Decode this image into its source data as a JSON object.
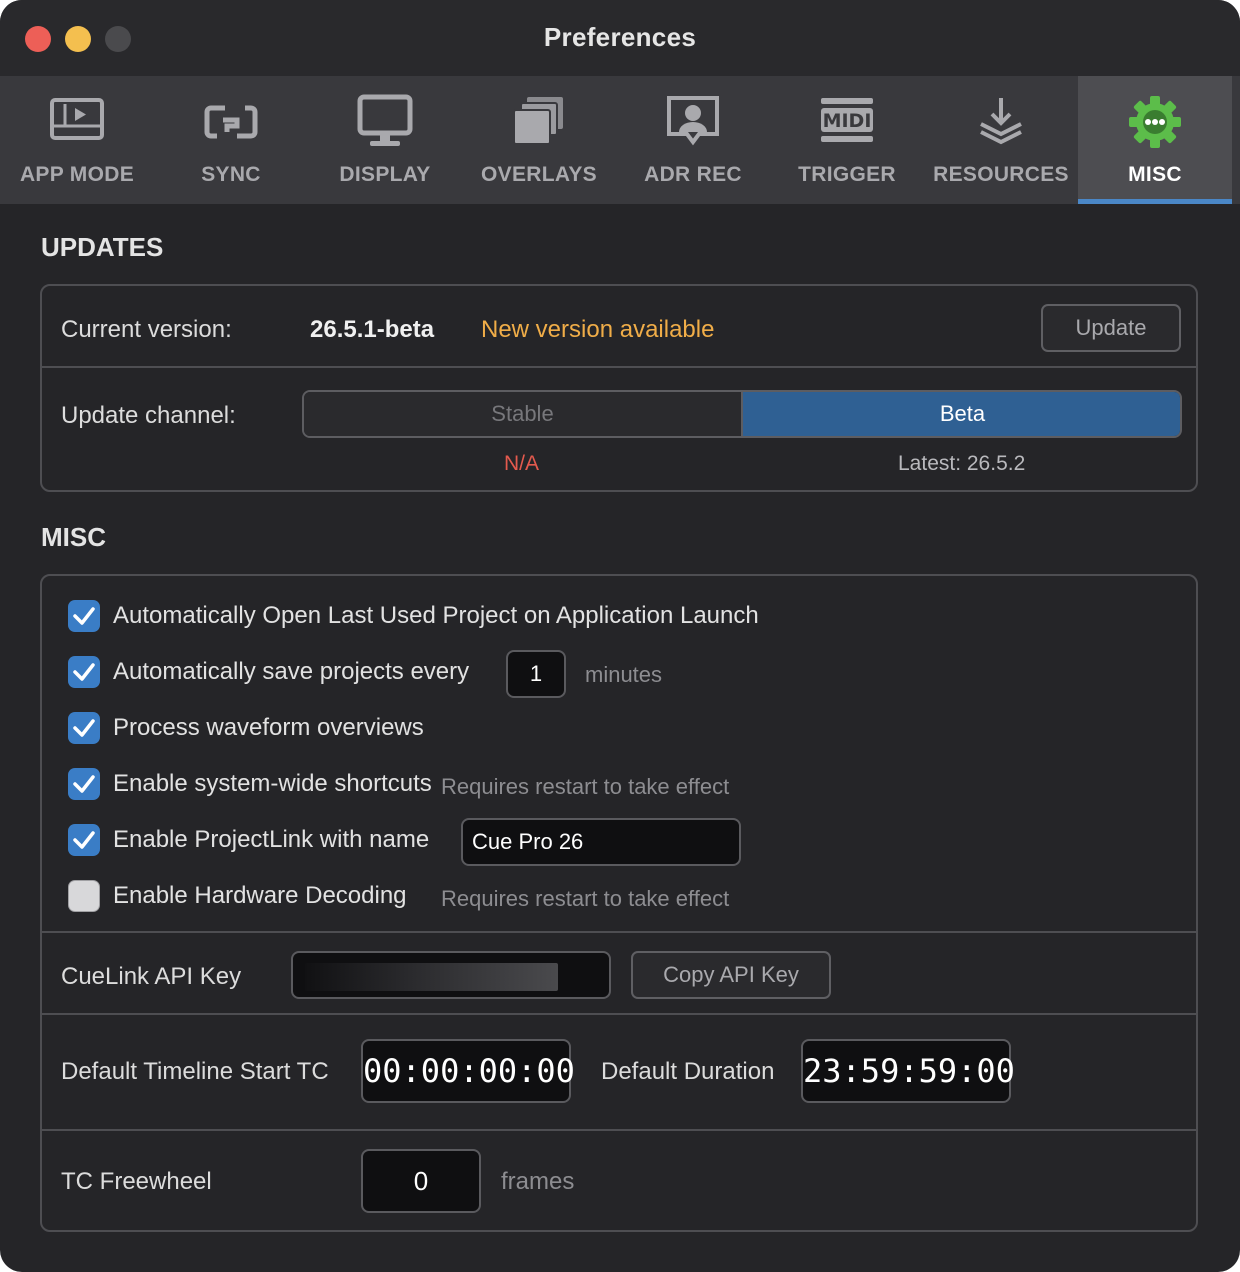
{
  "window": {
    "title": "Preferences"
  },
  "tabs": [
    {
      "label": "APP MODE",
      "icon": "app-mode-icon",
      "active": false
    },
    {
      "label": "SYNC",
      "icon": "sync-icon",
      "active": false
    },
    {
      "label": "DISPLAY",
      "icon": "display-icon",
      "active": false
    },
    {
      "label": "OVERLAYS",
      "icon": "overlays-icon",
      "active": false
    },
    {
      "label": "ADR REC",
      "icon": "adr-rec-icon",
      "active": false
    },
    {
      "label": "TRIGGER",
      "icon": "midi-icon",
      "active": false
    },
    {
      "label": "RESOURCES",
      "icon": "resources-icon",
      "active": false
    },
    {
      "label": "MISC",
      "icon": "gear-icon",
      "active": true
    }
  ],
  "updates": {
    "title": "UPDATES",
    "current_version_label": "Current version:",
    "current_version": "26.5.1-beta",
    "new_version_notice": "New version available",
    "update_button": "Update",
    "channel_label": "Update channel:",
    "channel_options": [
      "Stable",
      "Beta"
    ],
    "selected_channel": "Beta",
    "stable_status": "N/A",
    "beta_status": "Latest: 26.5.2"
  },
  "misc": {
    "title": "MISC",
    "options": [
      {
        "label": "Automatically Open Last Used Project on Application Launch",
        "checked": true
      },
      {
        "label": "Automatically save projects every",
        "checked": true,
        "value": "1",
        "unit": "minutes"
      },
      {
        "label": "Process waveform overviews",
        "checked": true
      },
      {
        "label": "Enable system-wide shortcuts",
        "checked": true,
        "hint": "Requires restart to take effect"
      },
      {
        "label": "Enable ProjectLink with name",
        "checked": true,
        "value": "Cue Pro 26"
      },
      {
        "label": "Enable Hardware Decoding",
        "checked": false,
        "hint": "Requires restart to take effect"
      }
    ],
    "api_key_label": "CueLink API Key",
    "copy_api_key_button": "Copy API Key",
    "timeline_start_label": "Default Timeline Start TC",
    "timeline_start_value": "00:00:00:00",
    "duration_label": "Default Duration",
    "duration_value": "23:59:59:00",
    "freewheel_label": "TC Freewheel",
    "freewheel_value": "0",
    "freewheel_unit": "frames"
  },
  "colors": {
    "accent": "#4a87c7",
    "selected_segment": "#2f6093",
    "warning": "#f0ad48",
    "error": "#e45a4e"
  }
}
